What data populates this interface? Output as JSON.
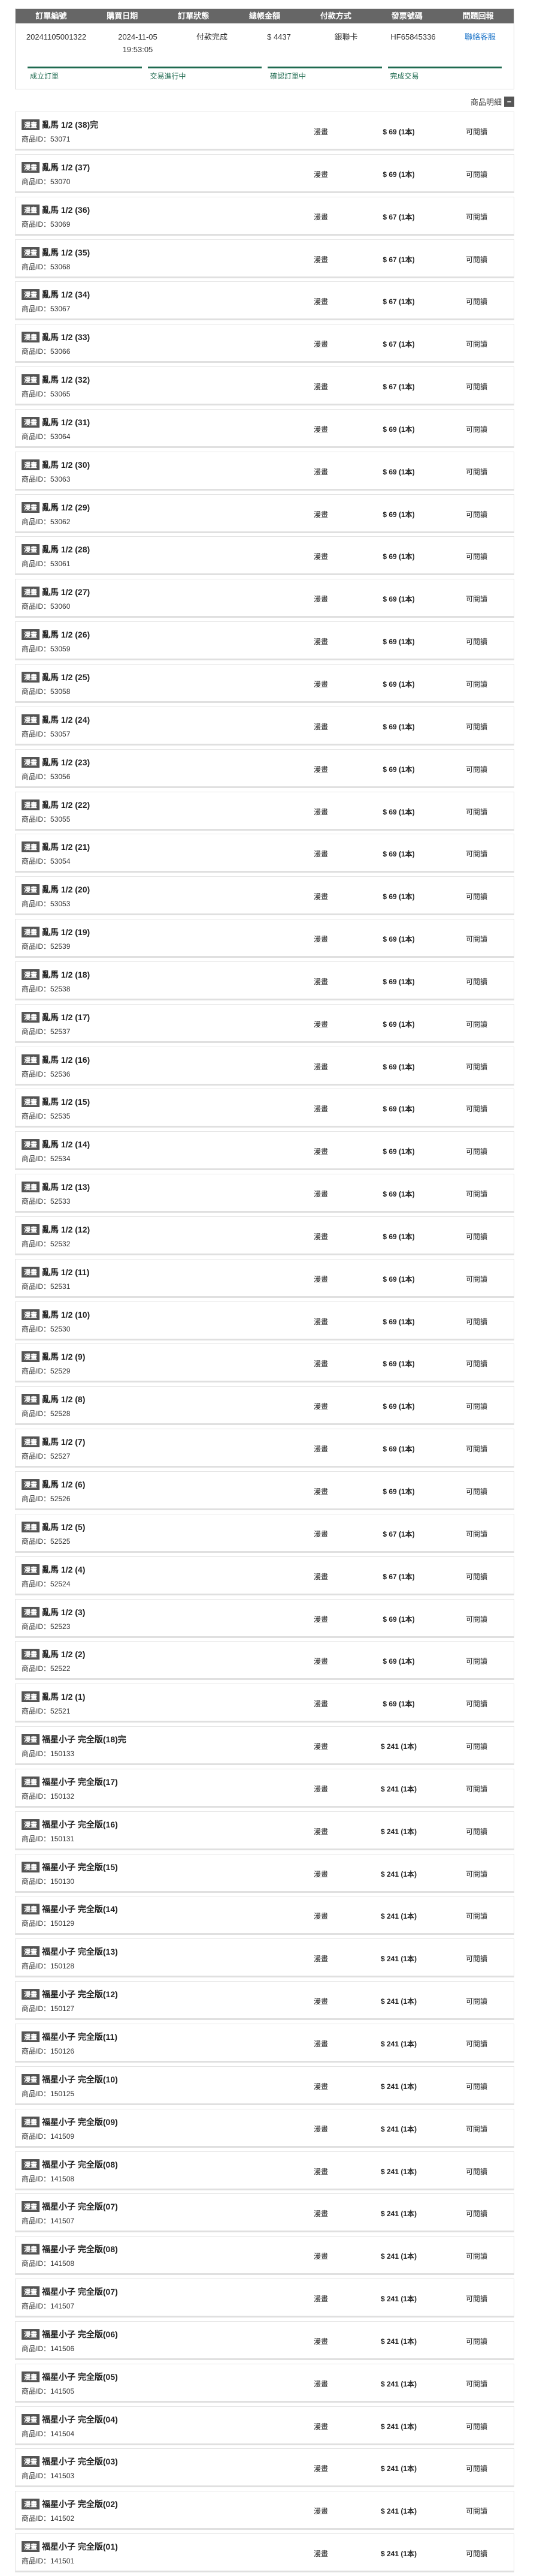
{
  "order": {
    "headers": [
      "訂單編號",
      "購買日期",
      "訂單狀態",
      "總帳金額",
      "付款方式",
      "發票號碼",
      "問題回報"
    ],
    "order_id": "20241105001322",
    "date": "2024-11-05 19:53:05",
    "status": "付款完成",
    "total": "$ 4437",
    "payment": "銀聯卡",
    "invoice": "HF65845336",
    "contact": "聯絡客服",
    "progress": [
      "成立訂單",
      "交易進行中",
      "確認訂單中",
      "完成交易"
    ]
  },
  "detail_label": "商品明細",
  "detail_toggle": "−",
  "id_prefix": "商品ID：",
  "items": [
    {
      "badge": "漫畫",
      "name": "亂馬 1/2 (38)完",
      "id": "53071",
      "type": "漫畫",
      "price": "$ 69 (1本)",
      "status": "可閱讀"
    },
    {
      "badge": "漫畫",
      "name": "亂馬 1/2 (37)",
      "id": "53070",
      "type": "漫畫",
      "price": "$ 69 (1本)",
      "status": "可閱讀"
    },
    {
      "badge": "漫畫",
      "name": "亂馬 1/2 (36)",
      "id": "53069",
      "type": "漫畫",
      "price": "$ 67 (1本)",
      "status": "可閱讀"
    },
    {
      "badge": "漫畫",
      "name": "亂馬 1/2 (35)",
      "id": "53068",
      "type": "漫畫",
      "price": "$ 67 (1本)",
      "status": "可閱讀"
    },
    {
      "badge": "漫畫",
      "name": "亂馬 1/2 (34)",
      "id": "53067",
      "type": "漫畫",
      "price": "$ 67 (1本)",
      "status": "可閱讀"
    },
    {
      "badge": "漫畫",
      "name": "亂馬 1/2 (33)",
      "id": "53066",
      "type": "漫畫",
      "price": "$ 67 (1本)",
      "status": "可閱讀"
    },
    {
      "badge": "漫畫",
      "name": "亂馬 1/2 (32)",
      "id": "53065",
      "type": "漫畫",
      "price": "$ 67 (1本)",
      "status": "可閱讀"
    },
    {
      "badge": "漫畫",
      "name": "亂馬 1/2 (31)",
      "id": "53064",
      "type": "漫畫",
      "price": "$ 69 (1本)",
      "status": "可閱讀"
    },
    {
      "badge": "漫畫",
      "name": "亂馬 1/2 (30)",
      "id": "53063",
      "type": "漫畫",
      "price": "$ 69 (1本)",
      "status": "可閱讀"
    },
    {
      "badge": "漫畫",
      "name": "亂馬 1/2 (29)",
      "id": "53062",
      "type": "漫畫",
      "price": "$ 69 (1本)",
      "status": "可閱讀"
    },
    {
      "badge": "漫畫",
      "name": "亂馬 1/2 (28)",
      "id": "53061",
      "type": "漫畫",
      "price": "$ 69 (1本)",
      "status": "可閱讀"
    },
    {
      "badge": "漫畫",
      "name": "亂馬 1/2 (27)",
      "id": "53060",
      "type": "漫畫",
      "price": "$ 69 (1本)",
      "status": "可閱讀"
    },
    {
      "badge": "漫畫",
      "name": "亂馬 1/2 (26)",
      "id": "53059",
      "type": "漫畫",
      "price": "$ 69 (1本)",
      "status": "可閱讀"
    },
    {
      "badge": "漫畫",
      "name": "亂馬 1/2 (25)",
      "id": "53058",
      "type": "漫畫",
      "price": "$ 69 (1本)",
      "status": "可閱讀"
    },
    {
      "badge": "漫畫",
      "name": "亂馬 1/2 (24)",
      "id": "53057",
      "type": "漫畫",
      "price": "$ 69 (1本)",
      "status": "可閱讀"
    },
    {
      "badge": "漫畫",
      "name": "亂馬 1/2 (23)",
      "id": "53056",
      "type": "漫畫",
      "price": "$ 69 (1本)",
      "status": "可閱讀"
    },
    {
      "badge": "漫畫",
      "name": "亂馬 1/2 (22)",
      "id": "53055",
      "type": "漫畫",
      "price": "$ 69 (1本)",
      "status": "可閱讀"
    },
    {
      "badge": "漫畫",
      "name": "亂馬 1/2 (21)",
      "id": "53054",
      "type": "漫畫",
      "price": "$ 69 (1本)",
      "status": "可閱讀"
    },
    {
      "badge": "漫畫",
      "name": "亂馬 1/2 (20)",
      "id": "53053",
      "type": "漫畫",
      "price": "$ 69 (1本)",
      "status": "可閱讀"
    },
    {
      "badge": "漫畫",
      "name": "亂馬 1/2 (19)",
      "id": "52539",
      "type": "漫畫",
      "price": "$ 69 (1本)",
      "status": "可閱讀"
    },
    {
      "badge": "漫畫",
      "name": "亂馬 1/2 (18)",
      "id": "52538",
      "type": "漫畫",
      "price": "$ 69 (1本)",
      "status": "可閱讀"
    },
    {
      "badge": "漫畫",
      "name": "亂馬 1/2 (17)",
      "id": "52537",
      "type": "漫畫",
      "price": "$ 69 (1本)",
      "status": "可閱讀"
    },
    {
      "badge": "漫畫",
      "name": "亂馬 1/2 (16)",
      "id": "52536",
      "type": "漫畫",
      "price": "$ 69 (1本)",
      "status": "可閱讀"
    },
    {
      "badge": "漫畫",
      "name": "亂馬 1/2 (15)",
      "id": "52535",
      "type": "漫畫",
      "price": "$ 69 (1本)",
      "status": "可閱讀"
    },
    {
      "badge": "漫畫",
      "name": "亂馬 1/2 (14)",
      "id": "52534",
      "type": "漫畫",
      "price": "$ 69 (1本)",
      "status": "可閱讀"
    },
    {
      "badge": "漫畫",
      "name": "亂馬 1/2 (13)",
      "id": "52533",
      "type": "漫畫",
      "price": "$ 69 (1本)",
      "status": "可閱讀"
    },
    {
      "badge": "漫畫",
      "name": "亂馬 1/2 (12)",
      "id": "52532",
      "type": "漫畫",
      "price": "$ 69 (1本)",
      "status": "可閱讀"
    },
    {
      "badge": "漫畫",
      "name": "亂馬 1/2 (11)",
      "id": "52531",
      "type": "漫畫",
      "price": "$ 69 (1本)",
      "status": "可閱讀"
    },
    {
      "badge": "漫畫",
      "name": "亂馬 1/2 (10)",
      "id": "52530",
      "type": "漫畫",
      "price": "$ 69 (1本)",
      "status": "可閱讀"
    },
    {
      "badge": "漫畫",
      "name": "亂馬 1/2 (9)",
      "id": "52529",
      "type": "漫畫",
      "price": "$ 69 (1本)",
      "status": "可閱讀"
    },
    {
      "badge": "漫畫",
      "name": "亂馬 1/2 (8)",
      "id": "52528",
      "type": "漫畫",
      "price": "$ 69 (1本)",
      "status": "可閱讀"
    },
    {
      "badge": "漫畫",
      "name": "亂馬 1/2 (7)",
      "id": "52527",
      "type": "漫畫",
      "price": "$ 69 (1本)",
      "status": "可閱讀"
    },
    {
      "badge": "漫畫",
      "name": "亂馬 1/2 (6)",
      "id": "52526",
      "type": "漫畫",
      "price": "$ 69 (1本)",
      "status": "可閱讀"
    },
    {
      "badge": "漫畫",
      "name": "亂馬 1/2 (5)",
      "id": "52525",
      "type": "漫畫",
      "price": "$ 67 (1本)",
      "status": "可閱讀"
    },
    {
      "badge": "漫畫",
      "name": "亂馬 1/2 (4)",
      "id": "52524",
      "type": "漫畫",
      "price": "$ 67 (1本)",
      "status": "可閱讀"
    },
    {
      "badge": "漫畫",
      "name": "亂馬 1/2 (3)",
      "id": "52523",
      "type": "漫畫",
      "price": "$ 69 (1本)",
      "status": "可閱讀"
    },
    {
      "badge": "漫畫",
      "name": "亂馬 1/2 (2)",
      "id": "52522",
      "type": "漫畫",
      "price": "$ 69 (1本)",
      "status": "可閱讀"
    },
    {
      "badge": "漫畫",
      "name": "亂馬 1/2 (1)",
      "id": "52521",
      "type": "漫畫",
      "price": "$ 69 (1本)",
      "status": "可閱讀"
    },
    {
      "badge": "漫畫",
      "name": "福星小子 完全版(18)完",
      "id": "150133",
      "type": "漫畫",
      "price": "$ 241 (1本)",
      "status": "可閱讀"
    },
    {
      "badge": "漫畫",
      "name": "福星小子 完全版(17)",
      "id": "150132",
      "type": "漫畫",
      "price": "$ 241 (1本)",
      "status": "可閱讀"
    },
    {
      "badge": "漫畫",
      "name": "福星小子 完全版(16)",
      "id": "150131",
      "type": "漫畫",
      "price": "$ 241 (1本)",
      "status": "可閱讀"
    },
    {
      "badge": "漫畫",
      "name": "福星小子 完全版(15)",
      "id": "150130",
      "type": "漫畫",
      "price": "$ 241 (1本)",
      "status": "可閱讀"
    },
    {
      "badge": "漫畫",
      "name": "福星小子 完全版(14)",
      "id": "150129",
      "type": "漫畫",
      "price": "$ 241 (1本)",
      "status": "可閱讀"
    },
    {
      "badge": "漫畫",
      "name": "福星小子 完全版(13)",
      "id": "150128",
      "type": "漫畫",
      "price": "$ 241 (1本)",
      "status": "可閱讀"
    },
    {
      "badge": "漫畫",
      "name": "福星小子 完全版(12)",
      "id": "150127",
      "type": "漫畫",
      "price": "$ 241 (1本)",
      "status": "可閱讀"
    },
    {
      "badge": "漫畫",
      "name": "福星小子 完全版(11)",
      "id": "150126",
      "type": "漫畫",
      "price": "$ 241 (1本)",
      "status": "可閱讀"
    },
    {
      "badge": "漫畫",
      "name": "福星小子 完全版(10)",
      "id": "150125",
      "type": "漫畫",
      "price": "$ 241 (1本)",
      "status": "可閱讀"
    },
    {
      "badge": "漫畫",
      "name": "福星小子 完全版(09)",
      "id": "141509",
      "type": "漫畫",
      "price": "$ 241 (1本)",
      "status": "可閱讀"
    },
    {
      "badge": "漫畫",
      "name": "福星小子 完全版(08)",
      "id": "141508",
      "type": "漫畫",
      "price": "$ 241 (1本)",
      "status": "可閱讀"
    },
    {
      "badge": "漫畫",
      "name": "福星小子 完全版(07)",
      "id": "141507",
      "type": "漫畫",
      "price": "$ 241 (1本)",
      "status": "可閱讀"
    },
    {
      "badge": "漫畫",
      "name": "福星小子 完全版(08)",
      "id": "141508",
      "type": "漫畫",
      "price": "$ 241 (1本)",
      "status": "可閱讀"
    },
    {
      "badge": "漫畫",
      "name": "福星小子 完全版(07)",
      "id": "141507",
      "type": "漫畫",
      "price": "$ 241 (1本)",
      "status": "可閱讀"
    },
    {
      "badge": "漫畫",
      "name": "福星小子 完全版(06)",
      "id": "141506",
      "type": "漫畫",
      "price": "$ 241 (1本)",
      "status": "可閱讀"
    },
    {
      "badge": "漫畫",
      "name": "福星小子 完全版(05)",
      "id": "141505",
      "type": "漫畫",
      "price": "$ 241 (1本)",
      "status": "可閱讀"
    },
    {
      "badge": "漫畫",
      "name": "福星小子 完全版(04)",
      "id": "141504",
      "type": "漫畫",
      "price": "$ 241 (1本)",
      "status": "可閱讀"
    },
    {
      "badge": "漫畫",
      "name": "福星小子 完全版(03)",
      "id": "141503",
      "type": "漫畫",
      "price": "$ 241 (1本)",
      "status": "可閱讀"
    },
    {
      "badge": "漫畫",
      "name": "福星小子 完全版(02)",
      "id": "141502",
      "type": "漫畫",
      "price": "$ 241 (1本)",
      "status": "可閱讀"
    },
    {
      "badge": "漫畫",
      "name": "福星小子 完全版(01)",
      "id": "141501",
      "type": "漫畫",
      "price": "$ 241 (1本)",
      "status": "可閱讀"
    }
  ]
}
